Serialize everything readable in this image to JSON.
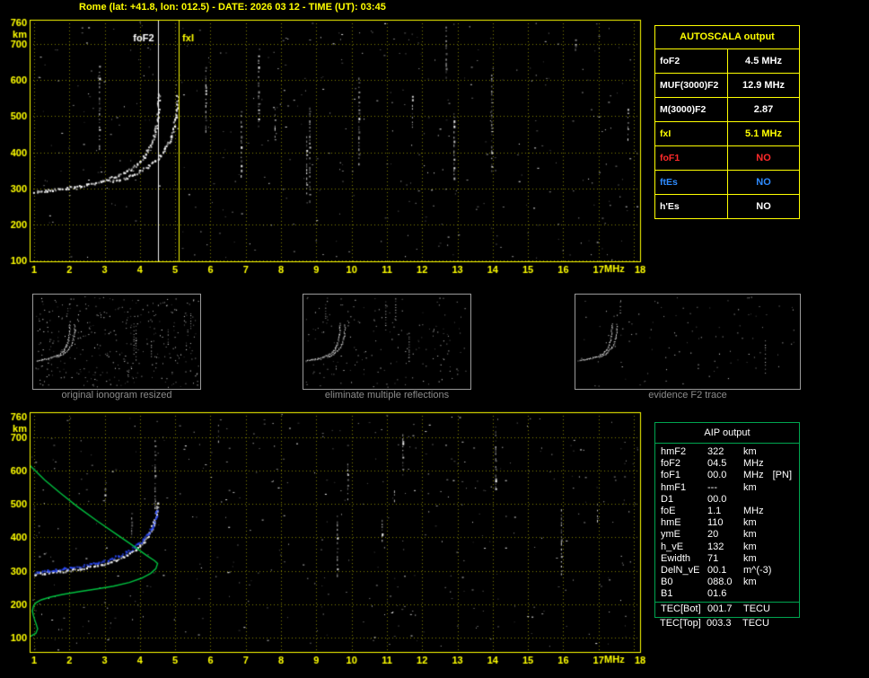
{
  "title": "Rome (lat: +41.8, lon: 012.5) - DATE: 2026 03 12 - TIME (UT): 03:45",
  "colors": {
    "background": "#000000",
    "yellow": "#ffff00",
    "white": "#ffffff",
    "red": "#ff2a2a",
    "blue": "#2e8bff",
    "green": "#00a550",
    "gray_caption": "#8c8c8c"
  },
  "autoscala": {
    "title": "AUTOSCALA output",
    "rows": [
      {
        "label": "foF2",
        "value": "4.5 MHz",
        "color": "#ffffff"
      },
      {
        "label": "MUF(3000)F2",
        "value": "12.9 MHz",
        "color": "#ffffff"
      },
      {
        "label": "M(3000)F2",
        "value": "2.87",
        "color": "#ffffff"
      },
      {
        "label": "fxI",
        "value": "5.1 MHz",
        "color": "#ffff00"
      },
      {
        "label": "foF1",
        "value": "NO",
        "color": "#ff2a2a"
      },
      {
        "label": "ftEs",
        "value": "NO",
        "color": "#2e8bff"
      },
      {
        "label": "h'Es",
        "value": "NO",
        "color": "#ffffff"
      }
    ]
  },
  "thumbnails": [
    {
      "caption": "original ionogram resized"
    },
    {
      "caption": "eliminate multiple reflections"
    },
    {
      "caption": "evidence F2 trace"
    }
  ],
  "aip": {
    "title": "AIP output",
    "rows": [
      {
        "name": "hmF2",
        "value": "322",
        "unit": "km",
        "extra": ""
      },
      {
        "name": "foF2",
        "value": "04.5",
        "unit": "MHz",
        "extra": ""
      },
      {
        "name": "foF1",
        "value": "00.0",
        "unit": "MHz",
        "extra": "[PN]"
      },
      {
        "name": "hmF1",
        "value": "---",
        "unit": "km",
        "extra": ""
      },
      {
        "name": "D1",
        "value": "00.0",
        "unit": "",
        "extra": ""
      },
      {
        "name": "foE",
        "value": "1.1",
        "unit": "MHz",
        "extra": ""
      },
      {
        "name": "hmE",
        "value": "110",
        "unit": "km",
        "extra": ""
      },
      {
        "name": "ymE",
        "value": "20",
        "unit": "km",
        "extra": ""
      },
      {
        "name": "h_vE",
        "value": "132",
        "unit": "km",
        "extra": ""
      },
      {
        "name": "Ewidth",
        "value": "71",
        "unit": "km",
        "extra": ""
      },
      {
        "name": "DelN_vE",
        "value": "00.1",
        "unit": "m^(-3)",
        "extra": ""
      },
      {
        "name": "B0",
        "value": "088.0",
        "unit": "km",
        "extra": ""
      },
      {
        "name": "B1",
        "value": "01.6",
        "unit": "",
        "extra": ""
      }
    ],
    "tec_rows": [
      {
        "name": "TEC[Bot]",
        "value": "001.7",
        "unit": "TECU"
      },
      {
        "name": "TEC[Top]",
        "value": "003.3",
        "unit": "TECU"
      }
    ]
  },
  "chart_data": [
    {
      "type": "scatter",
      "title": "main ionogram (echo trace, virtual height vs frequency)",
      "xlabel": "MHz",
      "ylabel": "km",
      "xlim": [
        1,
        18
      ],
      "ylim": [
        100,
        760
      ],
      "x_ticks": [
        1,
        2,
        3,
        4,
        5,
        6,
        7,
        8,
        9,
        10,
        11,
        12,
        13,
        14,
        15,
        16,
        17,
        18
      ],
      "y_ticks": [
        100,
        200,
        300,
        400,
        500,
        600,
        700
      ],
      "y_top_label": "760",
      "grid": "dotted",
      "legend": "none",
      "markers": [
        {
          "label": "foF2",
          "freq": 4.5,
          "color": "#ffffff",
          "label_side": "left"
        },
        {
          "label": "fxI",
          "freq": 5.1,
          "color": "#ffff00",
          "label_side": "right"
        }
      ],
      "series": [
        {
          "name": "O-mode echo trace",
          "color": "#ffffff",
          "points": [
            [
              1.0,
              291
            ],
            [
              1.15,
              293
            ],
            [
              1.3,
              295
            ],
            [
              1.5,
              297
            ],
            [
              1.7,
              299
            ],
            [
              1.9,
              302
            ],
            [
              2.1,
              305
            ],
            [
              2.3,
              308
            ],
            [
              2.5,
              312
            ],
            [
              2.7,
              316
            ],
            [
              2.9,
              321
            ],
            [
              3.1,
              327
            ],
            [
              3.3,
              334
            ],
            [
              3.5,
              343
            ],
            [
              3.7,
              354
            ],
            [
              3.85,
              364
            ],
            [
              4.0,
              377
            ],
            [
              4.1,
              390
            ],
            [
              4.2,
              405
            ],
            [
              4.3,
              424
            ],
            [
              4.38,
              445
            ],
            [
              4.44,
              468
            ],
            [
              4.48,
              490
            ],
            [
              4.5,
              512
            ],
            [
              4.51,
              540
            ],
            [
              4.52,
              565
            ]
          ]
        },
        {
          "name": "X-mode echo trace",
          "color": "#ffffff",
          "points": [
            [
              3.2,
              320
            ],
            [
              3.4,
              325
            ],
            [
              3.6,
              331
            ],
            [
              3.8,
              339
            ],
            [
              4.0,
              349
            ],
            [
              4.2,
              361
            ],
            [
              4.4,
              376
            ],
            [
              4.55,
              391
            ],
            [
              4.7,
              410
            ],
            [
              4.8,
              428
            ],
            [
              4.88,
              448
            ],
            [
              4.95,
              472
            ],
            [
              5.0,
              498
            ],
            [
              5.03,
              525
            ],
            [
              5.05,
              558
            ]
          ]
        }
      ]
    },
    {
      "type": "scatter",
      "title": "ionogram with restored trace and electron density profile",
      "xlabel": "MHz",
      "ylabel": "km",
      "xlim": [
        1,
        18
      ],
      "ylim": [
        100,
        760
      ],
      "x_ticks": [
        1,
        2,
        3,
        4,
        5,
        6,
        7,
        8,
        9,
        10,
        11,
        12,
        13,
        14,
        15,
        16,
        17,
        18
      ],
      "y_ticks": [
        100,
        200,
        300,
        400,
        500,
        600,
        700
      ],
      "y_top_label": "760",
      "grid": "dotted",
      "legend": "none",
      "markers": [],
      "series": [
        {
          "name": "echo trace",
          "color": "#ffffff",
          "points": [
            [
              1.0,
              291
            ],
            [
              1.15,
              293
            ],
            [
              1.3,
              295
            ],
            [
              1.5,
              297
            ],
            [
              1.7,
              299
            ],
            [
              1.9,
              302
            ],
            [
              2.1,
              305
            ],
            [
              2.3,
              308
            ],
            [
              2.5,
              312
            ],
            [
              2.7,
              316
            ],
            [
              2.9,
              321
            ],
            [
              3.1,
              327
            ],
            [
              3.3,
              334
            ],
            [
              3.5,
              343
            ],
            [
              3.7,
              354
            ],
            [
              3.85,
              364
            ],
            [
              4.0,
              377
            ],
            [
              4.1,
              390
            ],
            [
              4.2,
              405
            ],
            [
              4.3,
              424
            ],
            [
              4.38,
              445
            ],
            [
              4.44,
              468
            ],
            [
              4.48,
              490
            ],
            [
              4.5,
              505
            ]
          ]
        },
        {
          "name": "restored (scaled) trace",
          "color": "#2b4bff",
          "points": [
            [
              1.0,
              297
            ],
            [
              1.2,
              299
            ],
            [
              1.4,
              302
            ],
            [
              1.6,
              304
            ],
            [
              1.8,
              307
            ],
            [
              2.0,
              310
            ],
            [
              2.2,
              313
            ],
            [
              2.4,
              317
            ],
            [
              2.6,
              321
            ],
            [
              2.8,
              326
            ],
            [
              3.0,
              332
            ],
            [
              3.2,
              339
            ],
            [
              3.4,
              347
            ],
            [
              3.6,
              357
            ],
            [
              3.8,
              369
            ],
            [
              3.95,
              381
            ],
            [
              4.1,
              396
            ],
            [
              4.2,
              410
            ],
            [
              4.3,
              428
            ],
            [
              4.38,
              448
            ],
            [
              4.44,
              466
            ],
            [
              4.48,
              482
            ]
          ]
        },
        {
          "name": "electron density profile",
          "color": "#00c040",
          "line": true,
          "points": [
            [
              0.3,
              692
            ],
            [
              0.45,
              668
            ],
            [
              0.65,
              640
            ],
            [
              0.95,
              608
            ],
            [
              1.3,
              572
            ],
            [
              1.75,
              532
            ],
            [
              2.25,
              490
            ],
            [
              2.8,
              448
            ],
            [
              3.35,
              408
            ],
            [
              3.85,
              372
            ],
            [
              4.2,
              345
            ],
            [
              4.42,
              330
            ],
            [
              4.5,
              322
            ],
            [
              4.45,
              306
            ],
            [
              4.3,
              292
            ],
            [
              4.05,
              278
            ],
            [
              3.7,
              265
            ],
            [
              3.25,
              254
            ],
            [
              2.75,
              245
            ],
            [
              2.25,
              237
            ],
            [
              1.8,
              229
            ],
            [
              1.45,
              221
            ],
            [
              1.2,
              213
            ],
            [
              1.05,
              204
            ],
            [
              0.98,
              193
            ],
            [
              0.95,
              180
            ],
            [
              0.98,
              166
            ],
            [
              1.02,
              152
            ],
            [
              1.06,
              140
            ],
            [
              1.1,
              126
            ],
            [
              1.05,
              113
            ],
            [
              0.92,
              105
            ],
            [
              0.72,
              97
            ],
            [
              0.52,
              90
            ],
            [
              0.38,
              82
            ],
            [
              0.28,
              72
            ],
            [
              0.2,
              60
            ],
            [
              0.15,
              50
            ]
          ]
        }
      ]
    }
  ]
}
